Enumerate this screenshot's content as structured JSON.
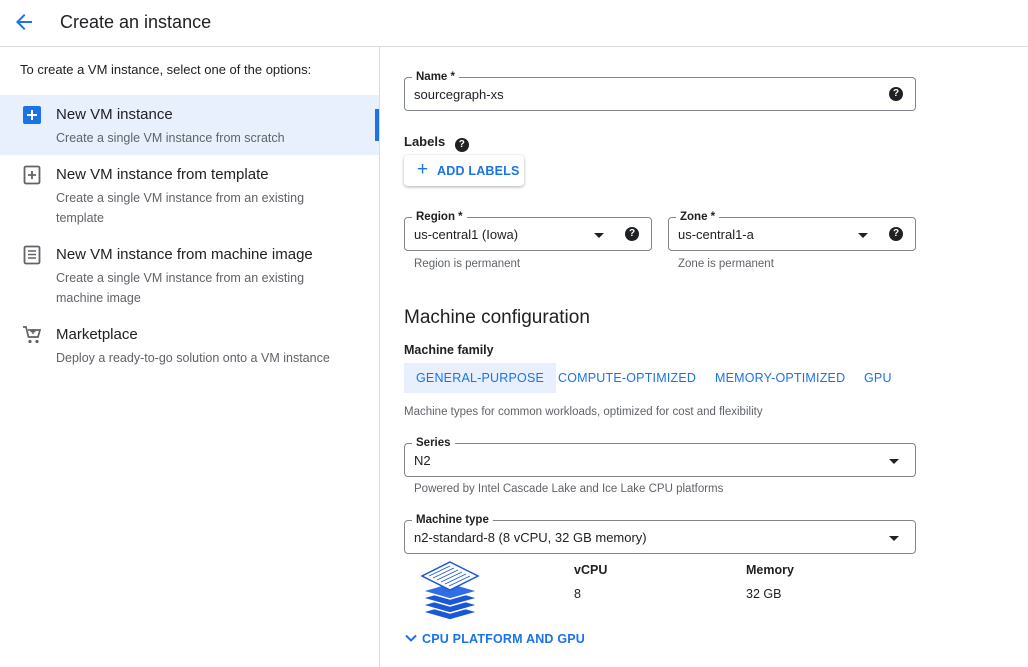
{
  "header": {
    "title": "Create an instance"
  },
  "left": {
    "intro": "To create a VM instance, select one of the options:",
    "options": [
      {
        "title": "New VM instance",
        "desc": "Create a single VM instance from scratch",
        "icon": "add-box-icon"
      },
      {
        "title": "New VM instance from template",
        "desc": "Create a single VM instance from an existing template",
        "icon": "template-icon"
      },
      {
        "title": "New VM instance from machine image",
        "desc": "Create a single VM instance from an existing machine image",
        "icon": "machine-image-icon"
      },
      {
        "title": "Marketplace",
        "desc": "Deploy a ready-to-go solution onto a VM instance",
        "icon": "cart-icon"
      }
    ]
  },
  "form": {
    "name": {
      "label": "Name *",
      "value": "sourcegraph-xs"
    },
    "labels": {
      "title": "Labels",
      "add_button": "ADD LABELS"
    },
    "region": {
      "label": "Region *",
      "value": "us-central1 (Iowa)",
      "hint": "Region is permanent"
    },
    "zone": {
      "label": "Zone *",
      "value": "us-central1-a",
      "hint": "Zone is permanent"
    },
    "machine_config": {
      "title": "Machine configuration",
      "family_label": "Machine family",
      "tabs": [
        "GENERAL-PURPOSE",
        "COMPUTE-OPTIMIZED",
        "MEMORY-OPTIMIZED",
        "GPU"
      ],
      "family_desc": "Machine types for common workloads, optimized for cost and flexibility",
      "series": {
        "label": "Series",
        "value": "N2",
        "hint": "Powered by Intel Cascade Lake and Ice Lake CPU platforms"
      },
      "machine_type": {
        "label": "Machine type",
        "value": "n2-standard-8 (8 vCPU, 32 GB memory)"
      },
      "vcpu": {
        "label": "vCPU",
        "value": "8"
      },
      "memory": {
        "label": "Memory",
        "value": "32 GB"
      },
      "cpu_link": "CPU PLATFORM AND GPU"
    }
  },
  "colors": {
    "accent": "#1a73e8",
    "selected_bg": "#e8f0fe",
    "border": "#dadce0"
  }
}
